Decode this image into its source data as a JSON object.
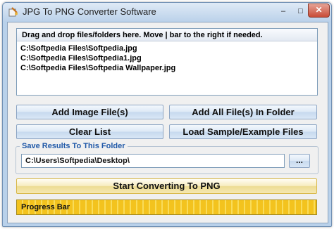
{
  "window": {
    "title": "JPG To PNG Converter Software",
    "controls": {
      "minimize": "–",
      "maximize": "□",
      "close": "✕"
    }
  },
  "file_list": {
    "header": "Drag and drop files/folders here. Move | bar to the right if needed.",
    "items": [
      "C:\\Softpedia Files\\Softpedia.jpg",
      "C:\\Softpedia Files\\Softpedia1.jpg",
      "C:\\Softpedia Files\\Softpedia Wallpaper.jpg"
    ]
  },
  "buttons": {
    "add_image_files": "Add Image File(s)",
    "add_all_files_in_folder": "Add All File(s) In Folder",
    "clear_list": "Clear List",
    "load_sample": "Load Sample/Example Files"
  },
  "save_results": {
    "label": "Save Results To This Folder",
    "path": "C:\\Users\\Softpedia\\Desktop\\",
    "browse_label": "..."
  },
  "start_button": "Start Converting To PNG",
  "progress": {
    "label": "Progress Bar"
  },
  "icons": {
    "app": "converter-app-icon"
  }
}
